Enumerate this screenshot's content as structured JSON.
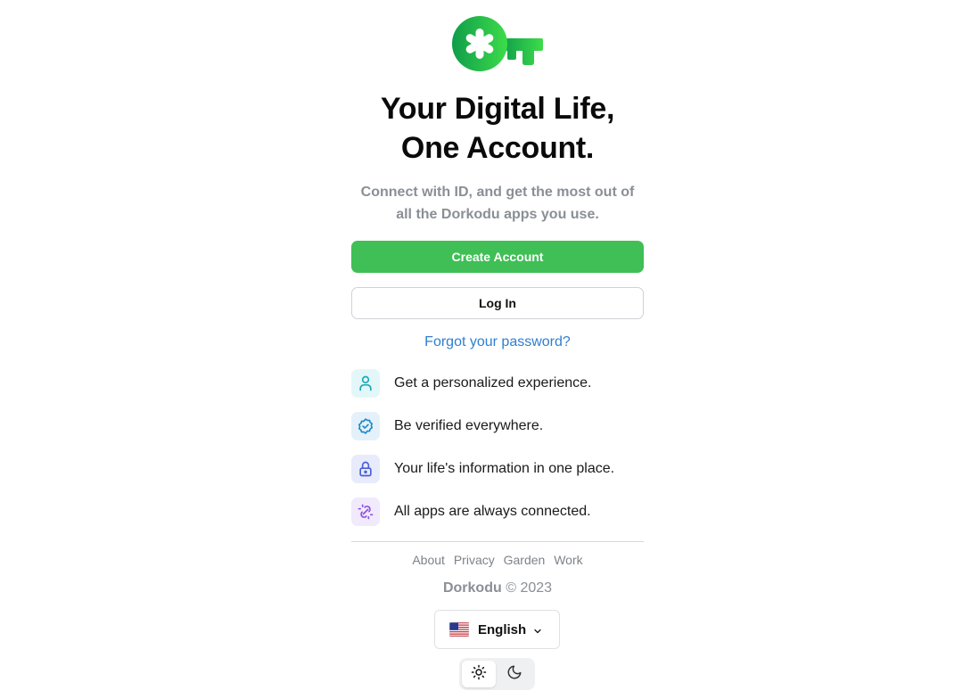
{
  "brand": {
    "logo_icon": "key-icon",
    "logo_colors": [
      "#0f9d4a",
      "#3ddc4a"
    ]
  },
  "hero": {
    "title_line1": "Your Digital Life,",
    "title_line2": "One Account.",
    "subtitle_line1": "Connect with ID, and get the most out of",
    "subtitle_line2": "all the Dorkodu apps you use."
  },
  "actions": {
    "create_label": "Create Account",
    "login_label": "Log In",
    "forgot_label": "Forgot your password?",
    "accent": "#3fbf55",
    "link_color": "#2f7fd0"
  },
  "features": [
    {
      "icon": "user-icon",
      "text": "Get a personalized experience.",
      "color": "#19a8b8",
      "bg": "#e3f7f9"
    },
    {
      "icon": "verified-badge-icon",
      "text": "Be verified everywhere.",
      "color": "#1e88c7",
      "bg": "#e4f1fa"
    },
    {
      "icon": "lock-icon",
      "text": "Your life's information in one place.",
      "color": "#4b5fd6",
      "bg": "#e8ebfb"
    },
    {
      "icon": "link-icon",
      "text": "All apps are always connected.",
      "color": "#8a4fe0",
      "bg": "#f1e9fc"
    }
  ],
  "footer": {
    "links": [
      "About",
      "Privacy",
      "Garden",
      "Work"
    ],
    "brand_name": "Dorkodu",
    "copyright": "© 2023"
  },
  "language": {
    "selected": "English",
    "flag_icon": "us-flag-icon"
  },
  "theme": {
    "light_icon": "sun-icon",
    "dark_icon": "moon-icon",
    "active": "light"
  }
}
